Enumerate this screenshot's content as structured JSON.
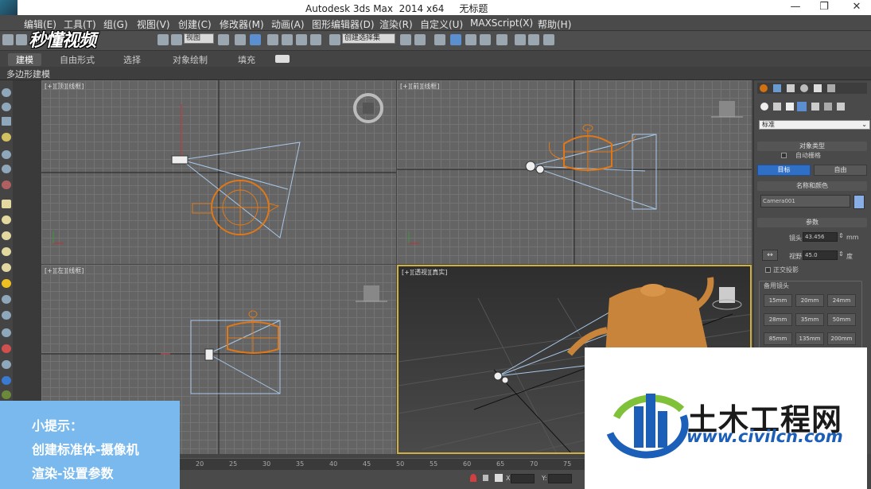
{
  "window": {
    "title": "Autodesk 3ds Max  2014 x64     无标题"
  },
  "menu": [
    "编辑(E)",
    "工具(T)",
    "组(G)",
    "视图(V)",
    "创建(C)",
    "修改器(M)",
    "动画(A)",
    "图形编辑器(D)",
    "渲染(R)",
    "自定义(U)",
    "MAXScript(X)",
    "帮助(H)"
  ],
  "toolbar": {
    "view_dropdown": "视图",
    "selection_set": "创建选择集"
  },
  "watermark": "秒懂视频",
  "ribbon": {
    "tabs": [
      "建模",
      "自由形式",
      "选择",
      "对象绘制",
      "填充"
    ],
    "sub": "多边形建模"
  },
  "viewports": {
    "top": "[+][顶][线框]",
    "front": "[+][前][线框]",
    "left": "[+][左][线框]",
    "perspective": "[+][透视][真实]"
  },
  "command_panel": {
    "dropdown": "标准",
    "object_type": "对象类型",
    "auto_grid": "自动栅格",
    "btn_target": "目标",
    "btn_free": "自由",
    "name_color": "名称和颜色",
    "camera_name": "Camera001",
    "params": "参数",
    "lens_label": "镜头:",
    "lens_value": "43.456",
    "lens_unit": "mm",
    "fov_label": "视野:",
    "fov_value": "45.0",
    "fov_unit": "度",
    "ortho": "正交投影",
    "stock_lenses": "备用镜头",
    "lenses": [
      "15mm",
      "20mm",
      "24mm",
      "28mm",
      "35mm",
      "50mm",
      "85mm",
      "135mm",
      "200mm"
    ],
    "accent_color": "#2f6fc6"
  },
  "timeline": {
    "ticks": [
      "20",
      "25",
      "30",
      "35",
      "40",
      "45",
      "50",
      "55",
      "60",
      "65",
      "70",
      "75"
    ]
  },
  "status": {
    "x_label": "X:",
    "y_label": "Y:"
  },
  "hint": {
    "line1": "小提示：",
    "line2": "创建标准体-摄像机",
    "line3": "渲染-设置参数"
  },
  "logo": {
    "cn": "土木工程网",
    "url": "www.civilcn.com"
  }
}
